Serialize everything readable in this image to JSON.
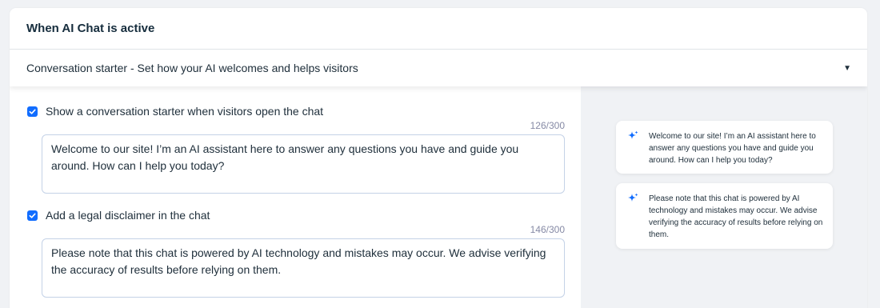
{
  "header": {
    "title": "When AI Chat is active"
  },
  "section": {
    "label": "Conversation starter - Set how your AI welcomes and helps visitors",
    "caret_icon": "caret-down-icon"
  },
  "starter": {
    "checkbox_label": "Show a conversation starter when visitors open the chat",
    "checked": true,
    "counter": "126/300",
    "text": "Welcome to our site! I’m an AI assistant here to answer any questions you have and guide you around. How can I help you today?"
  },
  "disclaimer": {
    "checkbox_label": "Add a legal disclaimer in the chat",
    "checked": true,
    "counter": "146/300",
    "text": "Please note that this chat is powered by AI technology and mistakes may occur. We advise verifying the accuracy of results before relying on them."
  },
  "preview": {
    "messages": [
      {
        "icon": "ai-sparkle-icon",
        "text": "Welcome to our site! I’m an AI assistant here to answer any questions you have and guide you around. How can I help you today?"
      },
      {
        "icon": "ai-sparkle-icon",
        "text": "Please note that this chat is powered by AI technology and mistakes may occur. We advise verifying the accuracy of results before relying on them."
      }
    ]
  },
  "colors": {
    "accent": "#116dff",
    "background": "#f0f2f5",
    "border": "#c4d2e7",
    "text": "#20303c",
    "muted": "#868aa5"
  }
}
